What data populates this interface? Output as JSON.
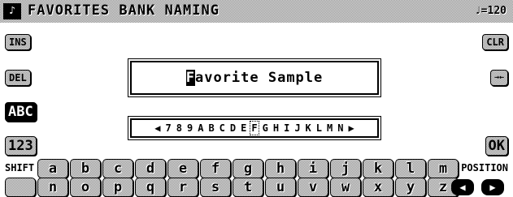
{
  "header": {
    "title": "FAVORITES BANK NAMING",
    "tempo": "♩=120",
    "icon": "bank-icon"
  },
  "left_buttons": {
    "ins": "INS",
    "del": "DEL",
    "abc": "ABC",
    "num": "123",
    "shift": "SHIFT"
  },
  "right_buttons": {
    "clr": "CLR",
    "space": "→←",
    "ok": "OK",
    "position": "POSITION",
    "left_arrow": "◀",
    "right_arrow": "▶"
  },
  "name": {
    "cursor_char": "F",
    "rest": "avorite Sample"
  },
  "char_strip": {
    "left_arrow": "◀",
    "chars": [
      "7",
      "8",
      "9",
      "A",
      "B",
      "C",
      "D",
      "E",
      "F",
      "G",
      "H",
      "I",
      "J",
      "K",
      "L",
      "M",
      "N"
    ],
    "selected": "F",
    "right_arrow": "▶"
  },
  "keyboard": {
    "row1": [
      "a",
      "b",
      "c",
      "d",
      "e",
      "f",
      "g",
      "h",
      "i",
      "j",
      "k",
      "l",
      "m"
    ],
    "row2": [
      "",
      "n",
      "o",
      "p",
      "q",
      "r",
      "s",
      "t",
      "u",
      "v",
      "w",
      "x",
      "y",
      "z"
    ]
  }
}
